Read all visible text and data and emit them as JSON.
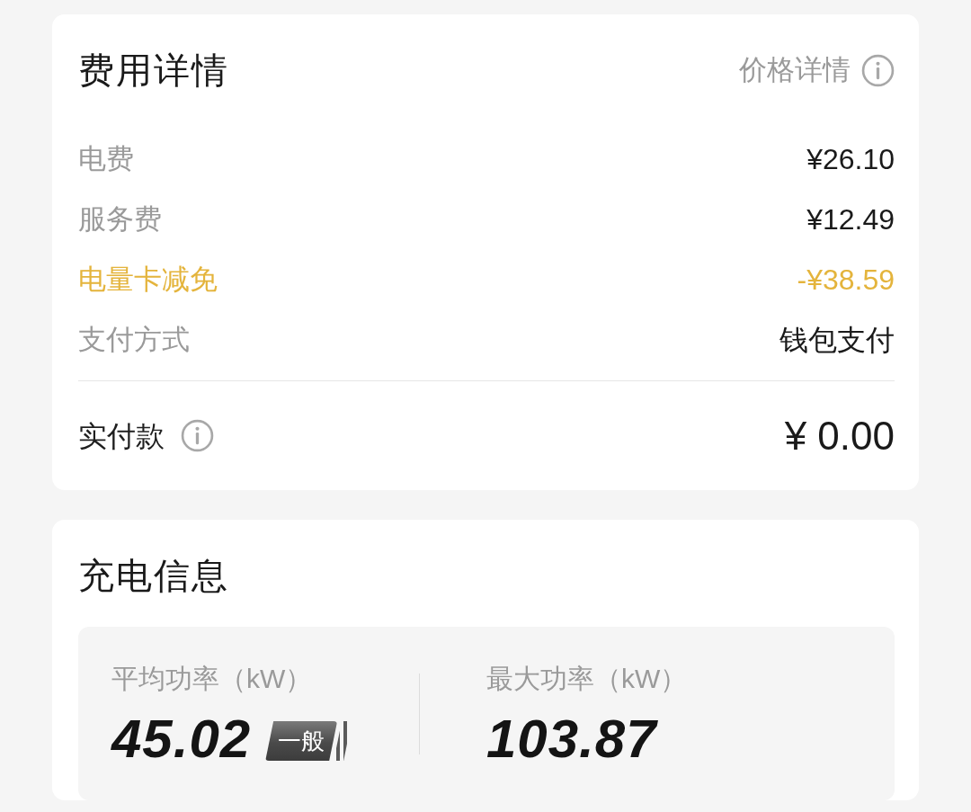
{
  "fee_details": {
    "title": "费用详情",
    "price_details_link": "价格详情",
    "items": [
      {
        "kind": "normal",
        "label": "电费",
        "value": "¥26.10"
      },
      {
        "kind": "normal",
        "label": "服务费",
        "value": "¥12.49"
      },
      {
        "kind": "discount",
        "label": "电量卡减免",
        "value": "-¥38.59"
      },
      {
        "kind": "normal",
        "label": "支付方式",
        "value": "钱包支付"
      }
    ],
    "total": {
      "label": "实付款",
      "value": "¥ 0.00"
    }
  },
  "charging_info": {
    "title": "充电信息",
    "stats": [
      {
        "label": "平均功率（kW）",
        "value": "45.02",
        "badge": "一般"
      },
      {
        "label": "最大功率（kW）",
        "value": "103.87"
      }
    ]
  }
}
